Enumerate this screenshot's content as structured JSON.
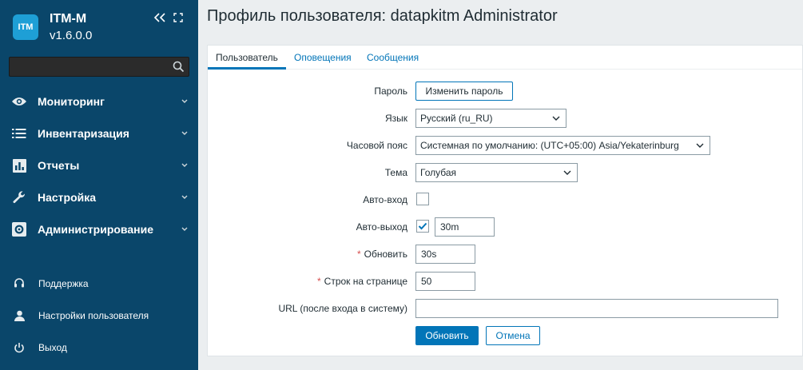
{
  "sidebar": {
    "logo_text": "ITM",
    "app_title": "ITM-M",
    "app_version": "v1.6.0.0",
    "search": {
      "value": "",
      "placeholder": ""
    },
    "menu": [
      {
        "label": "Мониторинг",
        "icon": "eye-icon"
      },
      {
        "label": "Инвентаризация",
        "icon": "list-icon"
      },
      {
        "label": "Отчеты",
        "icon": "chart-icon"
      },
      {
        "label": "Настройка",
        "icon": "wrench-icon"
      },
      {
        "label": "Администрирование",
        "icon": "gear-icon"
      }
    ],
    "bottom": [
      {
        "label": "Поддержка",
        "icon": "headset-icon"
      },
      {
        "label": "Настройки пользователя",
        "icon": "user-icon"
      },
      {
        "label": "Выход",
        "icon": "power-icon"
      }
    ]
  },
  "page": {
    "title": "Профиль пользователя: datapkitm Administrator"
  },
  "tabs": [
    {
      "label": "Пользователь",
      "active": true
    },
    {
      "label": "Оповещения",
      "active": false
    },
    {
      "label": "Сообщения",
      "active": false
    }
  ],
  "form": {
    "password": {
      "label": "Пароль",
      "button": "Изменить пароль"
    },
    "language": {
      "label": "Язык",
      "value": "Русский (ru_RU)"
    },
    "timezone": {
      "label": "Часовой пояс",
      "value": "Системная по умолчанию: (UTC+05:00) Asia/Yekaterinburg"
    },
    "theme": {
      "label": "Тема",
      "value": "Голубая"
    },
    "autologin": {
      "label": "Авто-вход",
      "checked": false
    },
    "autologout": {
      "label": "Авто-выход",
      "checked": true,
      "value": "30m"
    },
    "refresh": {
      "label": "Обновить",
      "required_mark": "*",
      "value": "30s"
    },
    "rows_per_page": {
      "label": "Строк на странице",
      "required_mark": "*",
      "value": "50"
    },
    "url": {
      "label": "URL (после входа в систему)",
      "value": ""
    },
    "submit": "Обновить",
    "cancel": "Отмена"
  },
  "colors": {
    "sidebar_bg": "#0a466a",
    "accent": "#0275b8",
    "required": "#d64e4e"
  }
}
